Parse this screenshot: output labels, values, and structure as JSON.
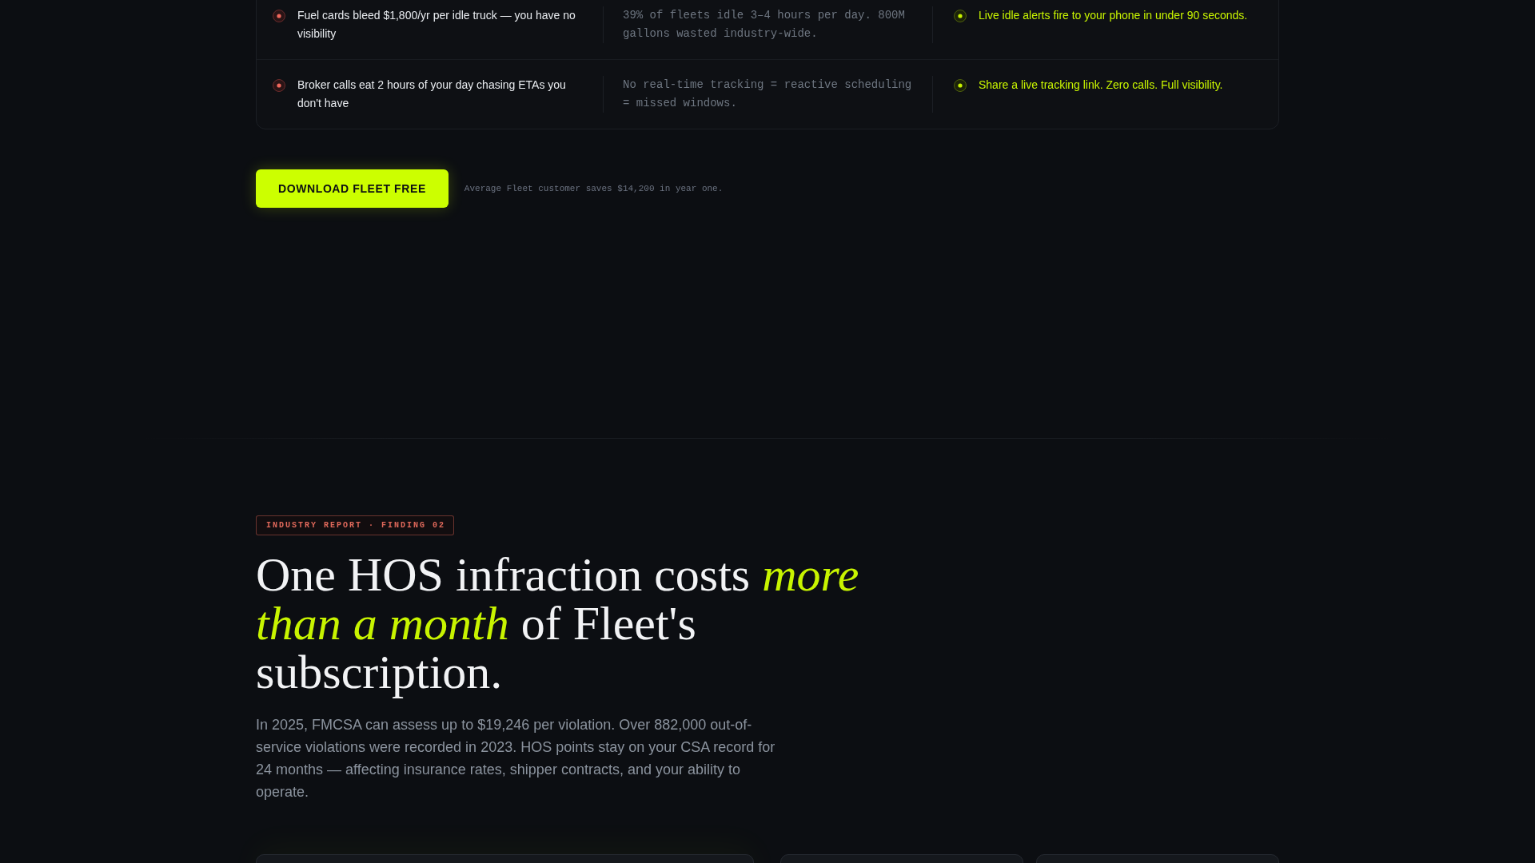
{
  "comparison_table": {
    "rows": [
      {
        "cells": [
          "Fuel cards bleed $1,800/yr per idle truck — you have no visibility",
          "39% of fleets idle 3–4 hours per day. 800M gallons wasted industry-wide.",
          "Live idle alerts fire to your phone in under 90 seconds."
        ]
      },
      {
        "cells": [
          "Broker calls eat 2 hours of your day chasing ETAs you don't have",
          "No real-time tracking = reactive scheduling = missed windows.",
          "Share a live tracking link. Zero calls. Full visibility."
        ]
      }
    ]
  },
  "cta": {
    "button": "DOWNLOAD FLEET FREE",
    "note": "Average Fleet customer saves $14,200 in year one."
  },
  "finding": {
    "badge": "INDUSTRY REPORT · FINDING 02",
    "headline": "One HOS infraction costs *more than a month* of Fleet's subscription.",
    "body": "In 2025, FMCSA can assess up to $19,246 per violation. Over 882,000 out-of-service violations were recorded in 2023. HOS points stay on your CSA record for 24 months — affecting insurance rates, shipper contracts, and your ability to operate."
  },
  "cards": [
    {
      "kind": "wide"
    },
    {
      "kind": "narrow"
    },
    {
      "kind": "narrow"
    }
  ]
}
